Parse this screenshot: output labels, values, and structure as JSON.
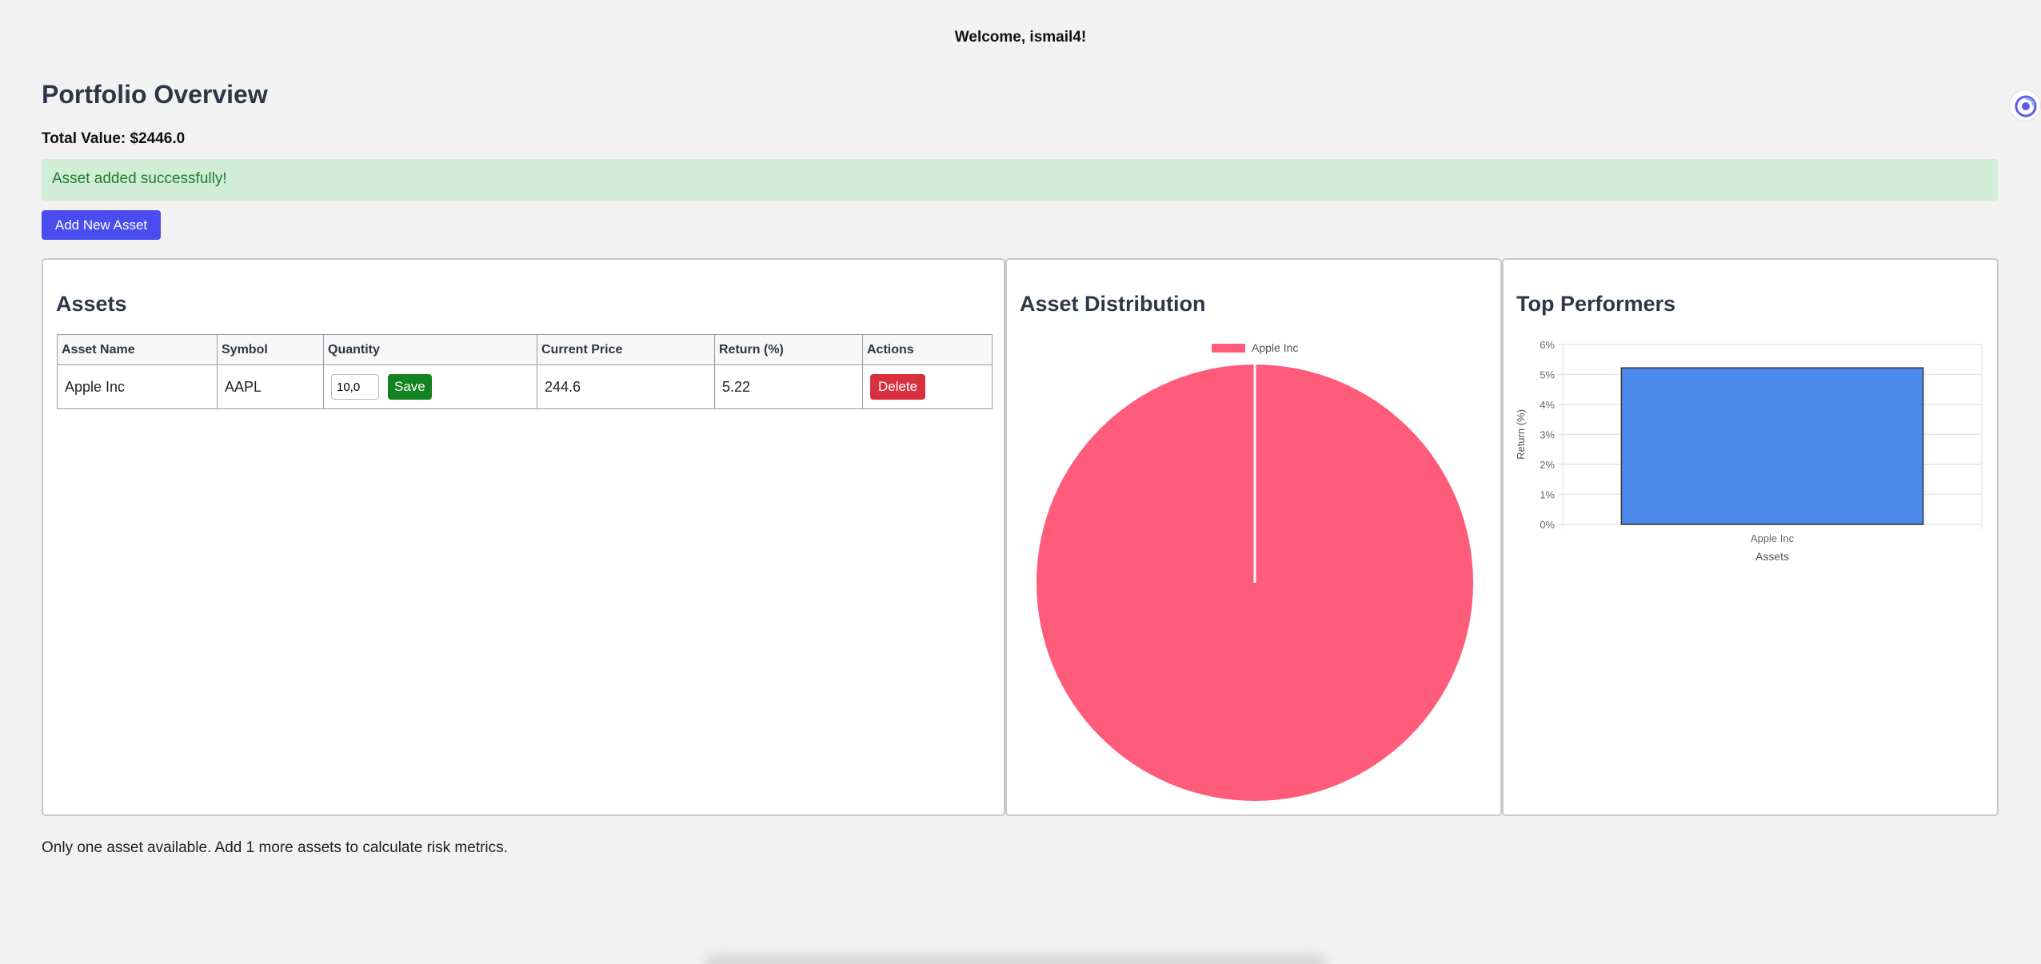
{
  "header": {
    "welcome": "Welcome, ismail4!"
  },
  "page": {
    "title": "Portfolio Overview",
    "total_value": "Total Value: $2446.0",
    "alert": "Asset added successfully!",
    "add_button": "Add New Asset",
    "footer_note": "Only one asset available. Add 1 more assets to calculate risk metrics."
  },
  "assets_card": {
    "title": "Assets",
    "columns": [
      "Asset Name",
      "Symbol",
      "Quantity",
      "Current Price",
      "Return (%)",
      "Actions"
    ],
    "rows": [
      {
        "name": "Apple Inc",
        "symbol": "AAPL",
        "quantity": "10,0",
        "price": "244.6",
        "return": "5.22",
        "save": "Save",
        "delete": "Delete"
      }
    ]
  },
  "distribution_card": {
    "title": "Asset Distribution",
    "chart_data": {
      "type": "pie",
      "labels": [
        "Apple Inc"
      ],
      "values": [
        100
      ],
      "colors": [
        "#ff5b7b"
      ],
      "legend": "top"
    }
  },
  "performers_card": {
    "title": "Top Performers",
    "chart_data": {
      "type": "bar",
      "categories": [
        "Apple Inc"
      ],
      "values": [
        5.22
      ],
      "xlabel": "Assets",
      "ylabel": "Return (%)",
      "ylim": [
        0,
        6
      ],
      "yticks": [
        "0%",
        "1%",
        "2%",
        "3%",
        "4%",
        "5%",
        "6%"
      ],
      "color": "#4a89ea",
      "grid": true
    }
  }
}
